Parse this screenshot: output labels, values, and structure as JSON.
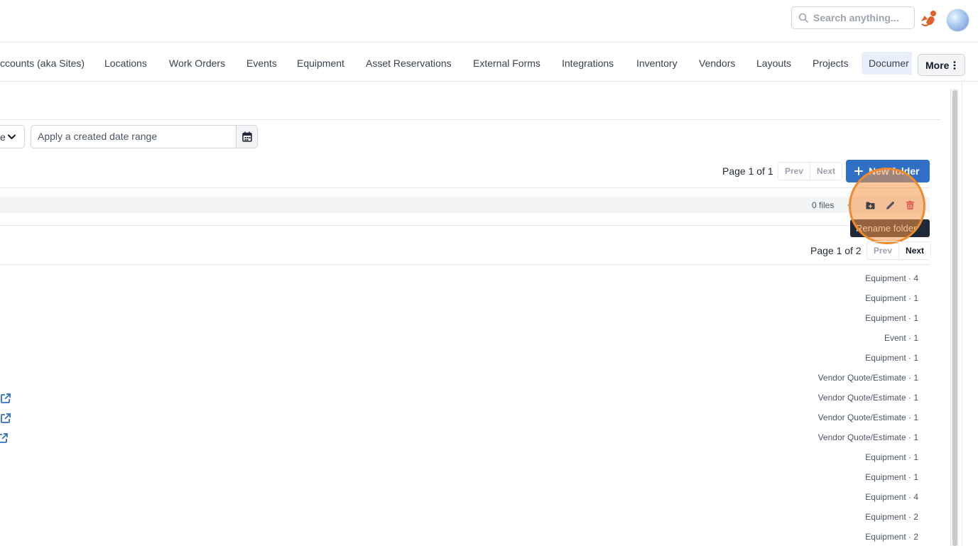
{
  "header": {
    "search_placeholder": "Search anything..."
  },
  "nav": {
    "tabs": [
      {
        "label": "ccounts (aka Sites)"
      },
      {
        "label": "Locations"
      },
      {
        "label": "Work Orders"
      },
      {
        "label": "Events"
      },
      {
        "label": "Equipment"
      },
      {
        "label": "Asset Reservations"
      },
      {
        "label": "External Forms"
      },
      {
        "label": "Integrations"
      },
      {
        "label": "Inventory"
      },
      {
        "label": "Vendors"
      },
      {
        "label": "Layouts"
      },
      {
        "label": "Projects"
      },
      {
        "label": "Documer"
      }
    ],
    "more_label": "More"
  },
  "filters": {
    "select_fragment": "e",
    "date_placeholder": "Apply a created date range"
  },
  "folders": {
    "page_label": "Page 1 of 1",
    "prev": "Prev",
    "next": "Next",
    "new_folder_label": "New folder",
    "row": {
      "files_count": "0 files",
      "dash": "-"
    },
    "tooltip": "Rename folder"
  },
  "files": {
    "page_label": "Page 1 of 2",
    "prev": "Prev",
    "next": "Next",
    "rows": [
      {
        "type": "Equipment · 4"
      },
      {
        "type": "Equipment · 1"
      },
      {
        "type": "Equipment · 1"
      },
      {
        "type": "Event · 1"
      },
      {
        "type": "Equipment · 1"
      },
      {
        "type": "Vendor Quote/Estimate · 1"
      },
      {
        "type": "Vendor Quote/Estimate · 1"
      },
      {
        "type": "Vendor Quote/Estimate · 1"
      },
      {
        "type": "Vendor Quote/Estimate · 1"
      },
      {
        "type": "Equipment · 1"
      },
      {
        "type": "Equipment · 1"
      },
      {
        "type": "Equipment · 4"
      },
      {
        "type": "Equipment · 2"
      },
      {
        "type": "Equipment · 2"
      }
    ]
  },
  "colors": {
    "primary": "#2f6fc6",
    "highlight": "#f08a2a",
    "delete": "#e05a4a"
  }
}
